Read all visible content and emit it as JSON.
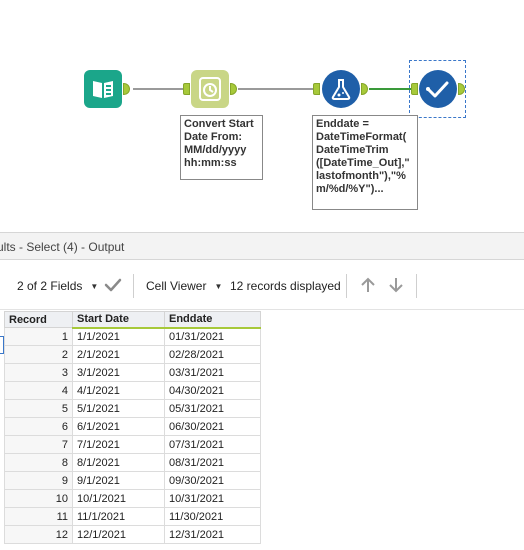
{
  "workflow": {
    "annotations": {
      "datetime": "Convert Start\nDate From:\nMM/dd/yyyy\nhh:mm:ss",
      "formula": "Enddate =\nDateTimeFormat(\nDateTimeTrim\n([DateTime_Out],\"\nlastofmonth\"),\"%\nm/%d/%Y\")..."
    },
    "tools": [
      {
        "name": "input-data",
        "icon": "book-icon"
      },
      {
        "name": "datetime",
        "icon": "clock-icon"
      },
      {
        "name": "formula",
        "icon": "flask-icon"
      },
      {
        "name": "select",
        "icon": "checkmark-icon"
      }
    ]
  },
  "panel": {
    "title": "ults - Select (4) - Output"
  },
  "toolbar": {
    "fields_label": "2 of 2 Fields",
    "viewer_label": "Cell Viewer",
    "records_label": "12 records displayed"
  },
  "table": {
    "headers": [
      "Record",
      "Start Date",
      "Enddate"
    ],
    "rows": [
      [
        "1",
        "1/1/2021",
        "01/31/2021"
      ],
      [
        "2",
        "2/1/2021",
        "02/28/2021"
      ],
      [
        "3",
        "3/1/2021",
        "03/31/2021"
      ],
      [
        "4",
        "4/1/2021",
        "04/30/2021"
      ],
      [
        "5",
        "5/1/2021",
        "05/31/2021"
      ],
      [
        "6",
        "6/1/2021",
        "06/30/2021"
      ],
      [
        "7",
        "7/1/2021",
        "07/31/2021"
      ],
      [
        "8",
        "8/1/2021",
        "08/31/2021"
      ],
      [
        "9",
        "9/1/2021",
        "09/30/2021"
      ],
      [
        "10",
        "10/1/2021",
        "10/31/2021"
      ],
      [
        "11",
        "11/1/2021",
        "11/30/2021"
      ],
      [
        "12",
        "12/1/2021",
        "12/31/2021"
      ]
    ]
  },
  "colors": {
    "anchor": "#a7c93a",
    "input_tool": "#1ba68a",
    "datetime_tool": "#c9d686",
    "formula_tool": "#1f5fa8",
    "select_tool": "#1f5fa8"
  }
}
